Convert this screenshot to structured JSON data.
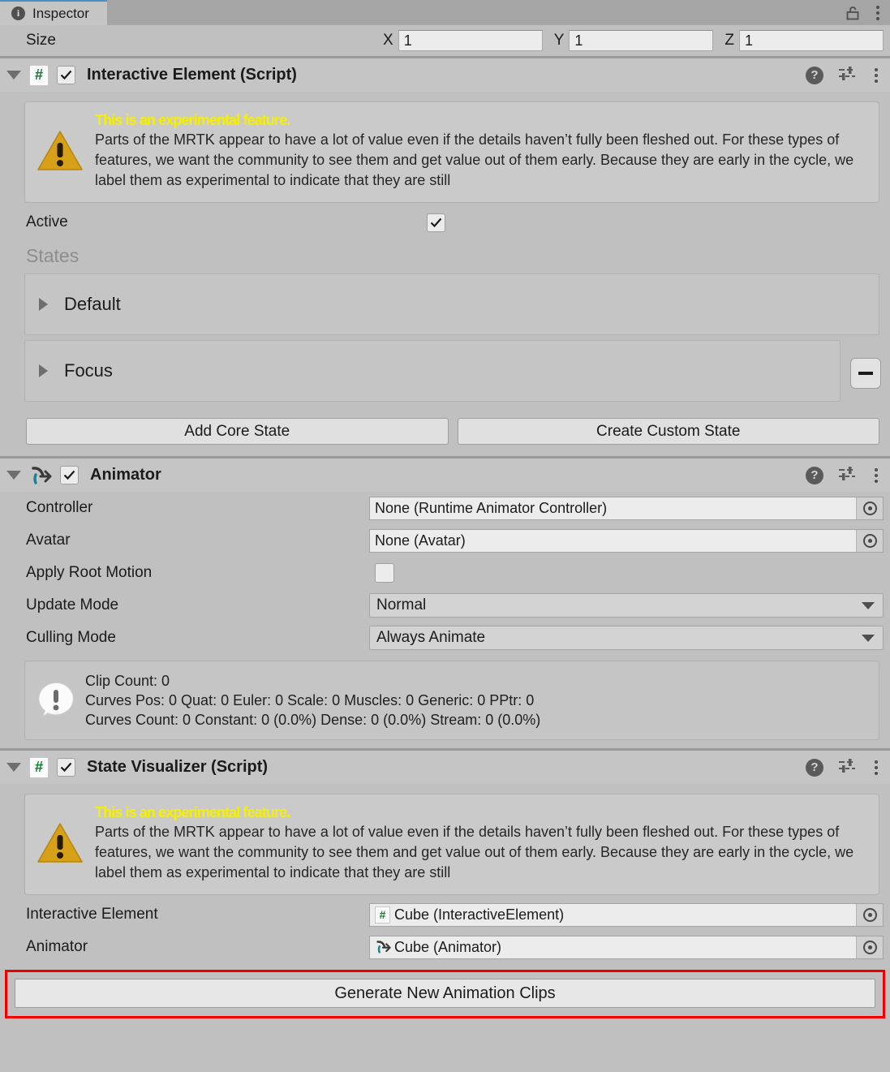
{
  "window": {
    "tab_label": "Inspector",
    "tab_icon": "info-circle-icon",
    "lock_icon": "unlocked-padlock-icon",
    "menu_icon": "kebab-menu-icon"
  },
  "size_row": {
    "label": "Size",
    "axes": [
      {
        "axis": "X",
        "value": "1"
      },
      {
        "axis": "Y",
        "value": "1"
      },
      {
        "axis": "Z",
        "value": "1"
      }
    ]
  },
  "experimental_warning": {
    "heading": "This is an experimental feature.",
    "body": "Parts of the MRTK appear to have a lot of value even if the details haven’t fully been fleshed out. For these types of features, we want the community to see them and get value out of them early. Because they are early in the cycle, we label them as experimental to indicate that they are still",
    "icon": "warning-triangle-icon"
  },
  "header_icons": {
    "help": "help-circle-icon",
    "preset": "preset-sliders-icon",
    "menu": "kebab-menu-icon"
  },
  "interactive_element": {
    "title": "Interactive Element (Script)",
    "icon": "csharp-script-icon",
    "enabled": true,
    "active": {
      "label": "Active",
      "checked": true
    },
    "states_title": "States",
    "states": [
      {
        "name": "Default",
        "expanded": false,
        "removable": false
      },
      {
        "name": "Focus",
        "expanded": false,
        "removable": true
      }
    ],
    "buttons": [
      {
        "label": "Add Core State"
      },
      {
        "label": "Create Custom State"
      }
    ]
  },
  "animator": {
    "title": "Animator",
    "icon": "animator-icon",
    "enabled": true,
    "fields": [
      {
        "label": "Controller",
        "type": "object",
        "value": "None (Runtime Animator Controller)"
      },
      {
        "label": "Avatar",
        "type": "object",
        "value": "None (Avatar)"
      },
      {
        "label": "Apply Root Motion",
        "type": "checkbox",
        "checked": false
      },
      {
        "label": "Update Mode",
        "type": "dropdown",
        "value": "Normal"
      },
      {
        "label": "Culling Mode",
        "type": "dropdown",
        "value": "Always Animate"
      }
    ],
    "info": {
      "icon": "info-bubble-icon",
      "lines": [
        "Clip Count: 0",
        "Curves Pos: 0 Quat: 0 Euler: 0 Scale: 0 Muscles: 0 Generic: 0 PPtr: 0",
        "Curves Count: 0 Constant: 0 (0.0%) Dense: 0 (0.0%) Stream: 0 (0.0%)"
      ]
    }
  },
  "state_visualizer": {
    "title": "State Visualizer (Script)",
    "icon": "csharp-script-icon",
    "enabled": true,
    "fields": [
      {
        "label": "Interactive Element",
        "value": "Cube (InteractiveElement)",
        "icon": "csharp-script-icon"
      },
      {
        "label": "Animator",
        "value": "Cube (Animator)",
        "icon": "animator-icon"
      }
    ],
    "generate_button": {
      "label": "Generate New Animation Clips",
      "highlight_color": "#ee0000"
    }
  },
  "colors": {
    "panel_bg": "#c0c0c0",
    "header_bg": "#c5c5c5",
    "tabbar_bg": "#a5a5a5",
    "warning_yellow": "#f6f000",
    "warning_triangle": "#d6a119",
    "script_green": "#127a2e",
    "animator_teal": "#1d7f91",
    "highlight_red": "#ee0000",
    "field_bg": "#ececec",
    "accent_blue": "#4a90c4"
  }
}
